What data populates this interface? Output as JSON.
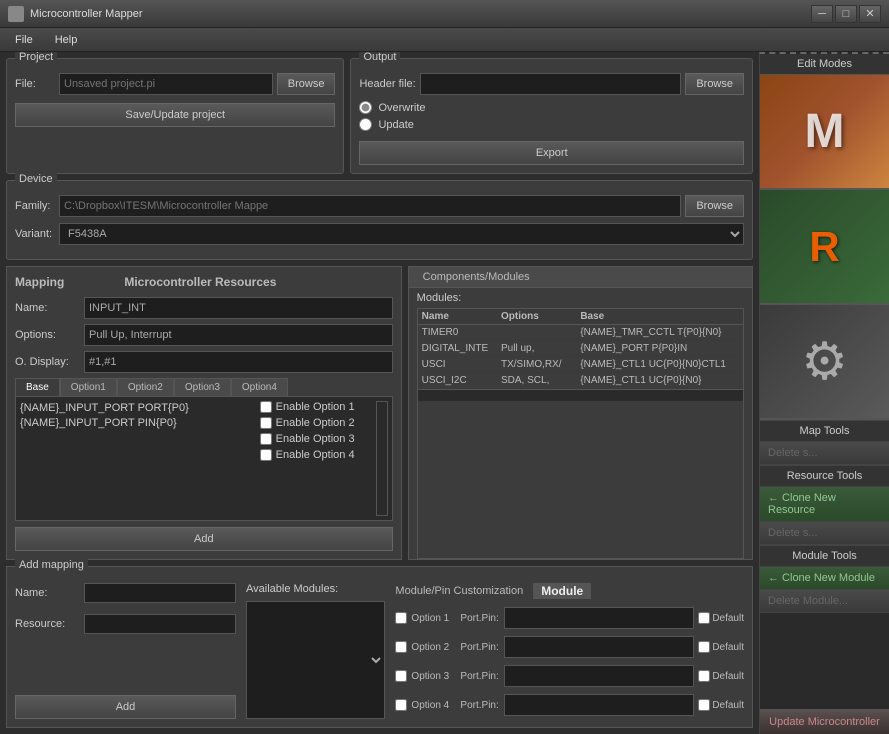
{
  "window": {
    "title": "Microcontroller Mapper",
    "controls": {
      "minimize": "─",
      "maximize": "□",
      "close": "✕"
    }
  },
  "menu": {
    "items": [
      "File",
      "Help"
    ]
  },
  "project": {
    "label": "Project",
    "file_label": "File:",
    "file_placeholder": "Unsaved project.pi",
    "browse_btn": "Browse",
    "save_btn": "Save/Update project"
  },
  "output": {
    "label": "Output",
    "header_label": "Header file:",
    "browse_btn": "Browse",
    "overwrite_label": "Overwrite",
    "update_label": "Update",
    "export_btn": "Export"
  },
  "device": {
    "label": "Device",
    "family_label": "Family:",
    "family_value": "C:\\Dropbox\\ITESM\\Microcontroller Mappe",
    "browse_btn": "Browse",
    "variant_label": "Variant:",
    "variant_value": "F5438A"
  },
  "mapping": {
    "title": "Mapping",
    "resources_title": "Microcontroller Resources",
    "name_label": "Name:",
    "name_value": "INPUT_INT",
    "options_label": "Options:",
    "options_value": "Pull Up, Interrupt",
    "odisplay_label": "O. Display:",
    "odisplay_value": "#1,#1",
    "tabs": [
      "Base",
      "Option1",
      "Option2",
      "Option3",
      "Option4"
    ],
    "active_tab": "Base",
    "code_lines": [
      "{NAME}_INPUT_PORT PORT{P0}",
      "{NAME}_INPUT_PORT PIN{P0}"
    ],
    "options": [
      "Enable Option 1",
      "Enable Option 2",
      "Enable Option 3",
      "Enable Option 4"
    ],
    "add_btn": "Add"
  },
  "components": {
    "tab_label": "Components/Modules",
    "modules_label": "Modules:",
    "columns": [
      "Name",
      "Options",
      "Base"
    ],
    "rows": [
      {
        "name": "TIMER0",
        "options": "",
        "base": "{NAME}_TMR_CCTL   T{P0}{N0}"
      },
      {
        "name": "DIGITAL_INTE",
        "options": "Pull up,",
        "base": "{NAME}_PORT  P{P0}IN"
      },
      {
        "name": "USCI",
        "options": "TX/SIMO,RX/",
        "base": "{NAME}_CTL1  UC{P0}{N0}CTL1"
      },
      {
        "name": "USCI_I2C",
        "options": "SDA, SCL,",
        "base": "{NAME}_CTL1  UC{P0}{N0}"
      }
    ]
  },
  "add_mapping": {
    "title": "Add mapping",
    "name_label": "Name:",
    "resource_label": "Resource:",
    "available_modules_label": "Available Modules:",
    "module_cust_label": "Module/Pin Customization",
    "module_badge": "Module",
    "options": [
      {
        "label": "Option 1",
        "port_pin": "Port.Pin:"
      },
      {
        "label": "Option 2",
        "port_pin": "Port.Pin:"
      },
      {
        "label": "Option 3",
        "port_pin": "Port.Pin:"
      },
      {
        "label": "Option 4",
        "port_pin": "Port.Pin:"
      }
    ],
    "default_label": "Default",
    "add_btn": "Add"
  },
  "right_sidebar": {
    "edit_modes_label": "Edit Modes",
    "map_tools_label": "Map Tools",
    "map_delete_btn": "Delete s...",
    "resource_tools_label": "Resource Tools",
    "clone_resource_btn": "← Clone New Resource",
    "delete_resource_btn": "Delete s...",
    "module_tools_label": "Module Tools",
    "clone_module_btn": "← Clone New Module",
    "delete_module_btn": "Delete Module...",
    "update_btn": "Update Microcontroller"
  }
}
